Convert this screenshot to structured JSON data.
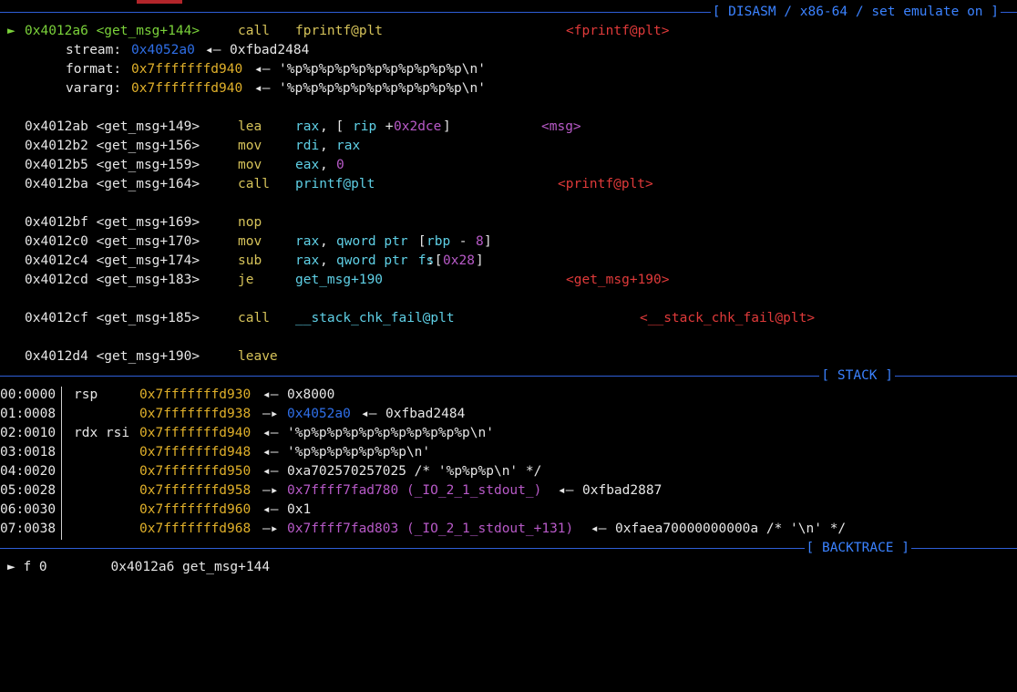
{
  "disasm_header": "[ DISASM / x86-64 / set emulate on ]",
  "stack_header": "[ STACK ]",
  "backtrace_header": "[ BACKTRACE ]",
  "current_marker": "►",
  "current": {
    "address": "0x4012a6 <get_msg+144>",
    "mnemonic": "call",
    "operand": "fprintf@plt",
    "target": "<fprintf@plt>"
  },
  "args": [
    {
      "label": "stream:",
      "addr": "0x4052a0",
      "arrow": "◂—",
      "value": "0xfbad2484"
    },
    {
      "label": "format:",
      "addr": "0x7fffffffd940",
      "arrow": "◂—",
      "value": "'%p%p%p%p%p%p%p%p%p%p%p\\n'"
    },
    {
      "label": "vararg:",
      "addr": "0x7fffffffd940",
      "arrow": "◂—",
      "value": "'%p%p%p%p%p%p%p%p%p%p%p\\n'"
    }
  ],
  "instructions": [
    {
      "address": "0x4012ab <get_msg+149>",
      "mnemonic": "lea",
      "op1": "rax",
      "op_mid": ", [",
      "op2": "rip",
      "op_plus": " + ",
      "op3": "0x2dce",
      "op_end": "]",
      "target": "<msg>"
    },
    {
      "address": "0x4012b2 <get_msg+156>",
      "mnemonic": "mov",
      "op1": "rdi",
      "op_mid": ", ",
      "op2": "rax"
    },
    {
      "address": "0x4012b5 <get_msg+159>",
      "mnemonic": "mov",
      "op1": "eax",
      "op_mid": ", ",
      "op2": "0"
    },
    {
      "address": "0x4012ba <get_msg+164>",
      "mnemonic": "call",
      "op1": "printf@plt",
      "target": "<printf@plt>"
    },
    {
      "address": "0x4012bf <get_msg+169>",
      "mnemonic": "nop"
    },
    {
      "address": "0x4012c0 <get_msg+170>",
      "mnemonic": "mov",
      "op1": "rax",
      "op_mid": ", ",
      "op_kw": "qword ptr",
      "op_br": " [",
      "op2": "rbp",
      "op_minus": " - ",
      "op3": "8",
      "op_end": "]"
    },
    {
      "address": "0x4012c4 <get_msg+174>",
      "mnemonic": "sub",
      "op1": "rax",
      "op_mid": ", ",
      "op_kw": "qword ptr",
      "op_seg": " fs",
      "op_br": ":[",
      "op3": "0x28",
      "op_end": "]"
    },
    {
      "address": "0x4012cd <get_msg+183>",
      "mnemonic": "je",
      "op1": "get_msg+190",
      "target": "<get_msg+190>"
    },
    {
      "address": "0x4012cf <get_msg+185>",
      "mnemonic": "call",
      "op1": "__stack_chk_fail@plt",
      "target": "<__stack_chk_fail@plt>"
    },
    {
      "address": "0x4012d4 <get_msg+190>",
      "mnemonic": "leave"
    }
  ],
  "stack": [
    {
      "index": "00:0000",
      "regs": "rsp",
      "addr": "0x7fffffffd930",
      "arrow": "◂—",
      "value": "0x8000"
    },
    {
      "index": "01:0008",
      "regs": "",
      "addr": "0x7fffffffd938",
      "arrow": "—▸",
      "ptr": "0x4052a0",
      "arrow2": "◂—",
      "value": "0xfbad2484"
    },
    {
      "index": "02:0010",
      "regs": "rdx rsi",
      "addr": "0x7fffffffd940",
      "arrow": "◂—",
      "value": "'%p%p%p%p%p%p%p%p%p%p%p\\n'"
    },
    {
      "index": "03:0018",
      "regs": "",
      "addr": "0x7fffffffd948",
      "arrow": "◂—",
      "value": "'%p%p%p%p%p%p%p\\n'"
    },
    {
      "index": "04:0020",
      "regs": "",
      "addr": "0x7fffffffd950",
      "arrow": "◂—",
      "value": "0xa702570257025 /* '%p%p%p\\n' */"
    },
    {
      "index": "05:0028",
      "regs": "",
      "addr": "0x7fffffffd958",
      "arrow": "—▸",
      "ptr": "0x7ffff7fad780 (_IO_2_1_stdout_)",
      "arrow2": "◂—",
      "value": "0xfbad2887"
    },
    {
      "index": "06:0030",
      "regs": "",
      "addr": "0x7fffffffd960",
      "arrow": "◂—",
      "value": "0x1"
    },
    {
      "index": "07:0038",
      "regs": "",
      "addr": "0x7fffffffd968",
      "arrow": "—▸",
      "ptr": "0x7ffff7fad803 (_IO_2_1_stdout_+131)",
      "arrow2": "◂—",
      "value": "0xfaea70000000000a /* '\\n' */"
    }
  ],
  "backtrace_partial": "► f 0        0x4012a6 get_msg+144"
}
